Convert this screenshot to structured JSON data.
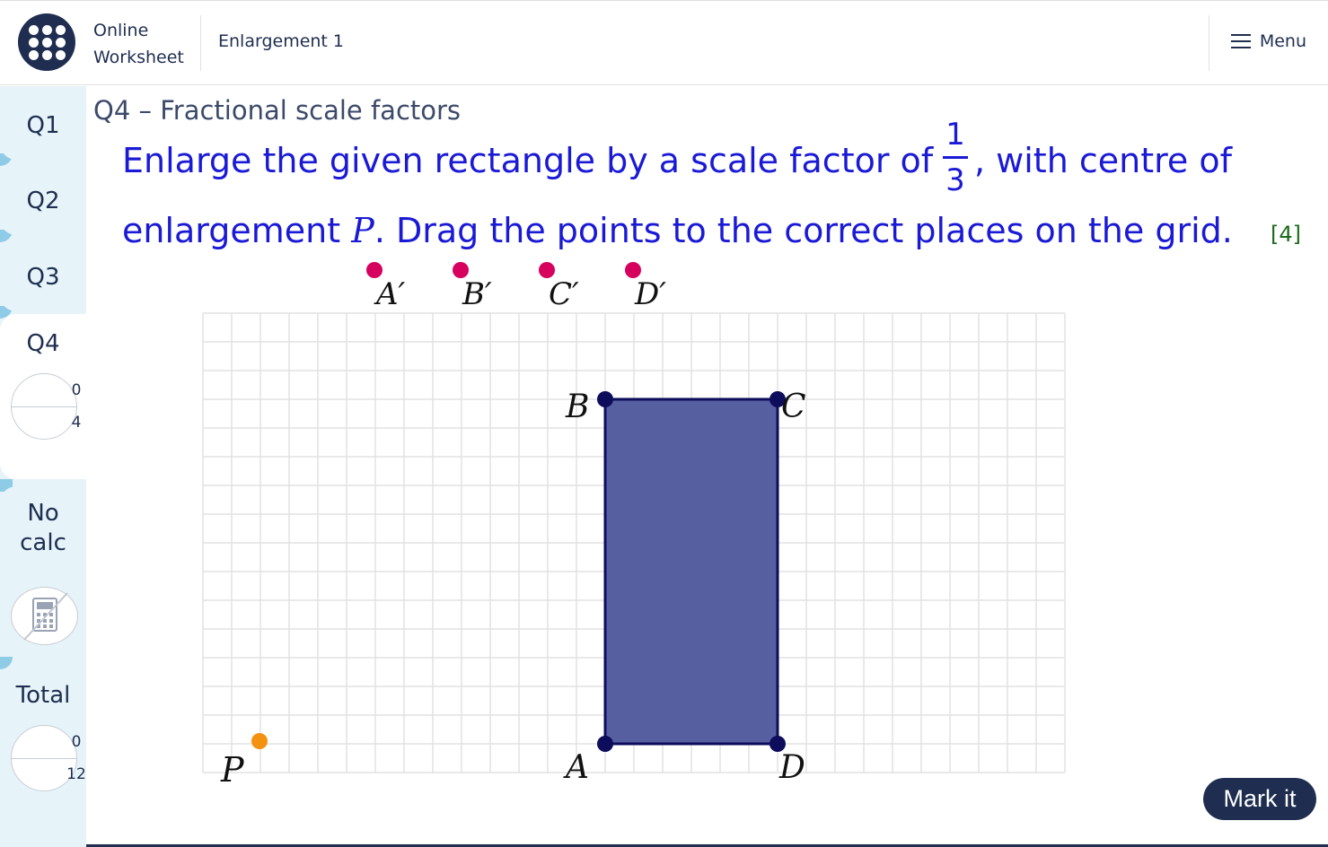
{
  "header": {
    "brand_line1": "Online",
    "brand_line2": "Worksheet",
    "title": "Enlargement 1",
    "menu_label": "Menu"
  },
  "sidebar": {
    "tabs": [
      {
        "label": "Q1"
      },
      {
        "label": "Q2"
      },
      {
        "label": "Q3"
      },
      {
        "label": "Q4",
        "score": "0",
        "max": "4"
      }
    ],
    "calc_line1": "No",
    "calc_line2": "calc",
    "total_label": "Total",
    "total_score": "0",
    "total_max": "12"
  },
  "question": {
    "heading": "Q4 – Fractional scale factors",
    "line1_before": "Enlarge the given rectangle by a scale factor of",
    "fraction_num": "1",
    "fraction_den": "3",
    "line1_after": ", with centre of",
    "line2_before": "enlargement ",
    "line2_var": "P",
    "line2_after": ". Drag the points to the correct places on the grid.",
    "marks": "[4]"
  },
  "draggables": [
    {
      "label": "A′"
    },
    {
      "label": "B′"
    },
    {
      "label": "C′"
    },
    {
      "label": "D′"
    }
  ],
  "grid": {
    "cols": 30,
    "rows": 16,
    "rectangle": {
      "A": [
        14,
        1
      ],
      "B": [
        14,
        13
      ],
      "C": [
        20,
        13
      ],
      "D": [
        20,
        1
      ]
    },
    "centre": {
      "label": "P",
      "x": 2,
      "y": 1
    }
  },
  "colors": {
    "rect_fill": "#565fa0",
    "rect_stroke": "#0d0d5c",
    "vertex": "#0d0d5c",
    "draggable": "#d6005e",
    "centre": "#f39110",
    "grid_line": "#e2e2e2"
  },
  "mark_button": "Mark it"
}
